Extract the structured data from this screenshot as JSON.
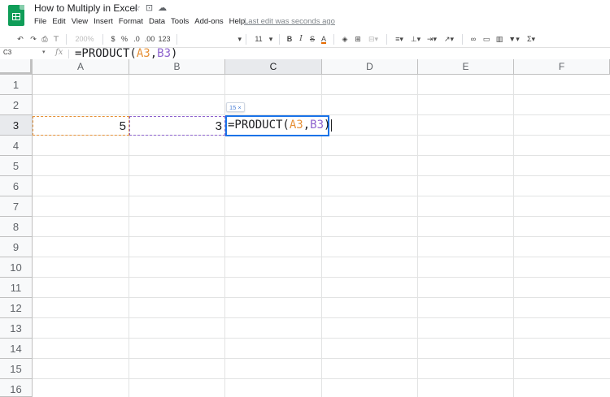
{
  "app": {
    "doc_title": "How to Multiply in Excel",
    "menus": [
      "File",
      "Edit",
      "View",
      "Insert",
      "Format",
      "Data",
      "Tools",
      "Add-ons",
      "Help"
    ],
    "last_edit": "Last edit was seconds ago",
    "title_icons": [
      "star-icon",
      "move-to-folder-icon",
      "cloud-status-icon"
    ]
  },
  "toolbar": {
    "zoom": "200%",
    "currency": "$",
    "percent": "%",
    "decrease_decimal": ".0",
    "increase_decimal": ".00",
    "more_formats": "123",
    "font_size": "11",
    "bold": "B",
    "italic": "I",
    "strikethrough": "S",
    "text_color": "A",
    "sum": "Σ",
    "icons": [
      "undo-icon",
      "redo-icon",
      "print-icon",
      "paint-format-icon",
      "fill-color-icon",
      "borders-icon",
      "merge-cells-icon",
      "align-left-icon",
      "vertical-align-icon",
      "text-wrap-icon",
      "text-rotate-icon",
      "insert-link-icon",
      "insert-comment-icon",
      "insert-chart-icon",
      "filter-icon",
      "functions-icon"
    ]
  },
  "formula_bar": {
    "name_box": "C3",
    "fx_label": "fx",
    "formula_prefix": "=PRODUCT(",
    "arg1": "A3",
    "comma": ",",
    "arg2": "B3",
    "formula_suffix": ")"
  },
  "grid": {
    "columns": [
      "A",
      "B",
      "C",
      "D",
      "E",
      "F"
    ],
    "rows": [
      "1",
      "2",
      "3",
      "4",
      "5",
      "6",
      "7",
      "8",
      "9",
      "10",
      "11",
      "12",
      "13",
      "14",
      "15",
      "16"
    ],
    "active_column": "C",
    "active_row": "3",
    "cells": {
      "A3": "5",
      "B3": "3"
    },
    "preview_tooltip": "15 ×"
  },
  "colors": {
    "active_cell_border": "#1a73e8",
    "ref_a_color": "#e69138",
    "ref_b_color": "#8e63ce",
    "logo_green": "#0f9d58"
  }
}
